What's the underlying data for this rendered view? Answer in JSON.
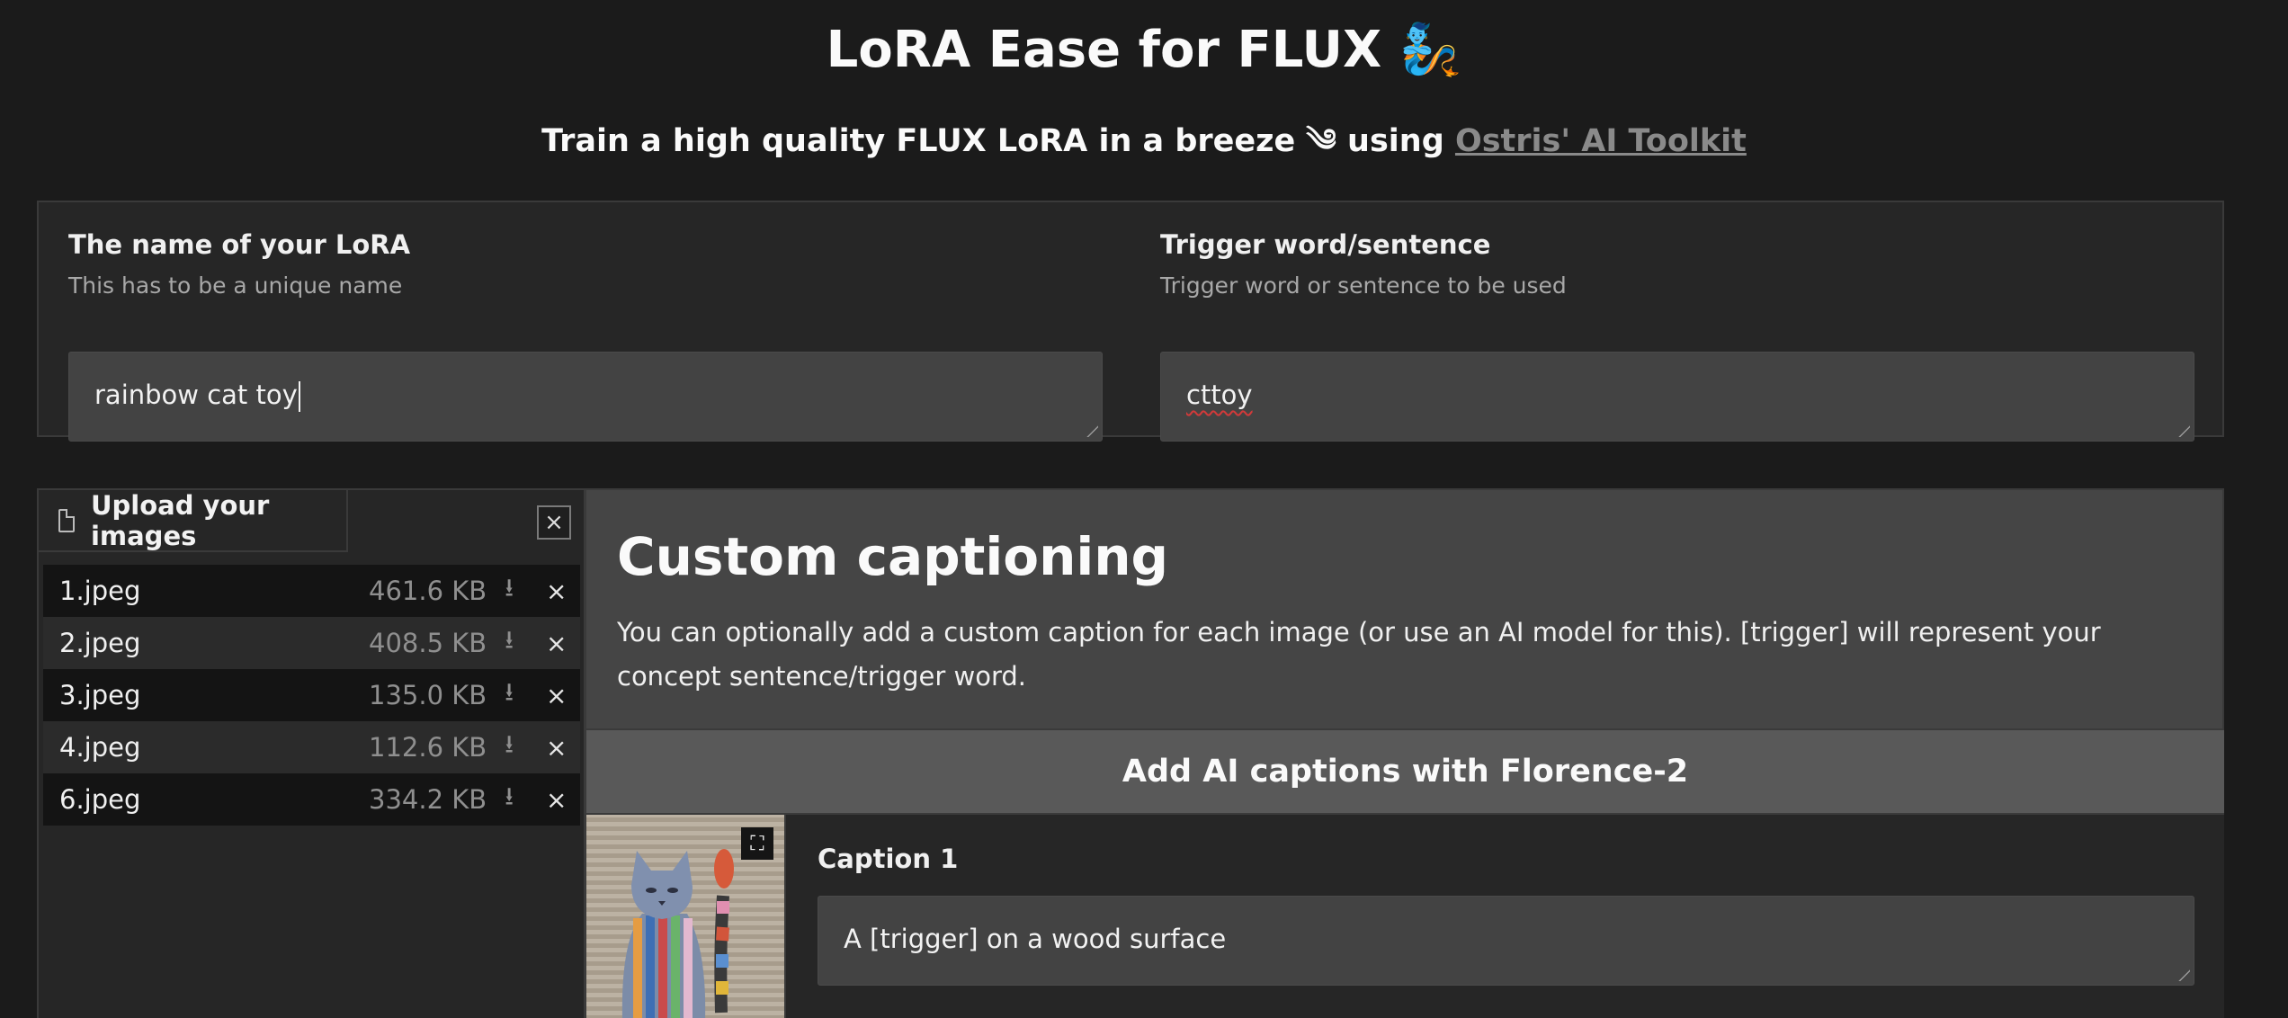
{
  "header": {
    "title": "LoRA Ease for FLUX 🧞",
    "subtitle_prefix": "Train a high quality FLUX LoRA in a breeze ༄ using ",
    "subtitle_link": "Ostris' AI Toolkit"
  },
  "form": {
    "lora_name": {
      "label": "The name of your LoRA",
      "info": "This has to be a unique name",
      "value": "rainbow cat toy"
    },
    "trigger": {
      "label": "Trigger word/sentence",
      "info": "Trigger word or sentence to be used",
      "value": "cttoy"
    }
  },
  "upload": {
    "tab_label": "Upload your images",
    "clear_label": "×",
    "files": [
      {
        "name": "1.jpeg",
        "size": "461.6 KB"
      },
      {
        "name": "2.jpeg",
        "size": "408.5 KB"
      },
      {
        "name": "3.jpeg",
        "size": "135.0 KB"
      },
      {
        "name": "4.jpeg",
        "size": "112.6 KB"
      },
      {
        "name": "6.jpeg",
        "size": "334.2 KB"
      }
    ],
    "download_glyph": "⭳",
    "remove_glyph": "×"
  },
  "captioning": {
    "heading": "Custom captioning",
    "description": "You can optionally add a custom caption for each image (or use an AI model for this). [trigger] will represent your concept sentence/trigger word.",
    "ai_button": "Add AI captions with Florence-2",
    "captions": [
      {
        "label": "Caption 1",
        "value": "A [trigger] on a wood surface"
      }
    ]
  },
  "colors": {
    "background": "#1b1b1b",
    "panel": "#262626",
    "input": "#434343",
    "link": "#8a8a8a"
  }
}
